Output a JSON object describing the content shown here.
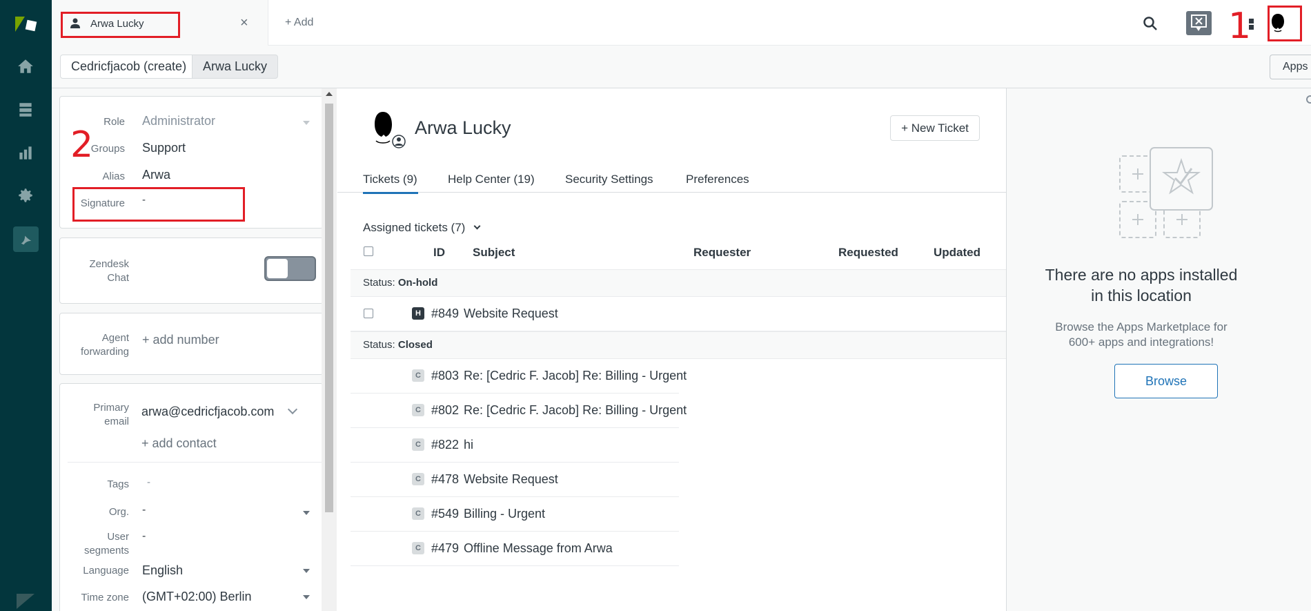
{
  "topbar": {
    "tab_label": "Arwa Lucky",
    "tab_close": "×",
    "add_tab": "+ Add",
    "annotation_1": "1"
  },
  "subbar": {
    "crumbs": [
      "Cedricfjacob (create)",
      "Arwa Lucky"
    ],
    "apps_label": "Apps"
  },
  "left_panel": {
    "annotation_2": "2",
    "fields": {
      "role_label": "Role",
      "role_value": "Administrator",
      "groups_label": "Groups",
      "groups_value": "Support",
      "alias_label": "Alias",
      "alias_value": "Arwa",
      "signature_label": "Signature",
      "signature_value": "-"
    },
    "chat": {
      "label_line1": "Zendesk",
      "label_line2": "Chat",
      "toggle_on": false
    },
    "forwarding": {
      "label_line1": "Agent",
      "label_line2": "forwarding",
      "action": "+ add number"
    },
    "contact": {
      "email_label_line1": "Primary",
      "email_label_line2": "email",
      "email_value": "arwa@cedricfjacob.com",
      "add_contact": "+ add contact",
      "tags_label": "Tags",
      "tags_value": "-",
      "org_label": "Org.",
      "org_value": "-",
      "segments_label_line1": "User",
      "segments_label_line2": "segments",
      "segments_value": "-",
      "language_label": "Language",
      "language_value": "English",
      "timezone_label": "Time zone",
      "timezone_value": "(GMT+02:00) Berlin"
    }
  },
  "main": {
    "user_name": "Arwa Lucky",
    "new_ticket": "+ New Ticket",
    "tabs": [
      "Tickets (9)",
      "Help Center (19)",
      "Security Settings",
      "Preferences"
    ],
    "assigned_label": "Assigned tickets (7)",
    "columns": [
      "ID",
      "Subject",
      "Requester",
      "Requested",
      "Updated"
    ],
    "groups": [
      {
        "status_prefix": "Status:",
        "status": "On-hold",
        "tickets": [
          {
            "badge": "H",
            "id": "#849",
            "subject": "Website Request"
          }
        ]
      },
      {
        "status_prefix": "Status:",
        "status": "Closed",
        "tickets": [
          {
            "badge": "C",
            "id": "#803",
            "subject": "Re: [Cedric F. Jacob] Re: Billing - Urgent"
          },
          {
            "badge": "C",
            "id": "#802",
            "subject": "Re: [Cedric F. Jacob] Re: Billing - Urgent"
          },
          {
            "badge": "C",
            "id": "#822",
            "subject": "hi"
          },
          {
            "badge": "C",
            "id": "#478",
            "subject": "Website Request"
          },
          {
            "badge": "C",
            "id": "#549",
            "subject": "Billing - Urgent"
          },
          {
            "badge": "C",
            "id": "#479",
            "subject": "Offline Message from Arwa"
          }
        ]
      }
    ]
  },
  "apps_panel": {
    "title": "There are no apps installed in this location",
    "subtitle": "Browse the Apps Marketplace for 600+ apps and integrations!",
    "browse": "Browse"
  },
  "colors": {
    "nav_bg": "#03363d",
    "accent": "#1f73b7",
    "annotation_red": "#e21e26"
  }
}
